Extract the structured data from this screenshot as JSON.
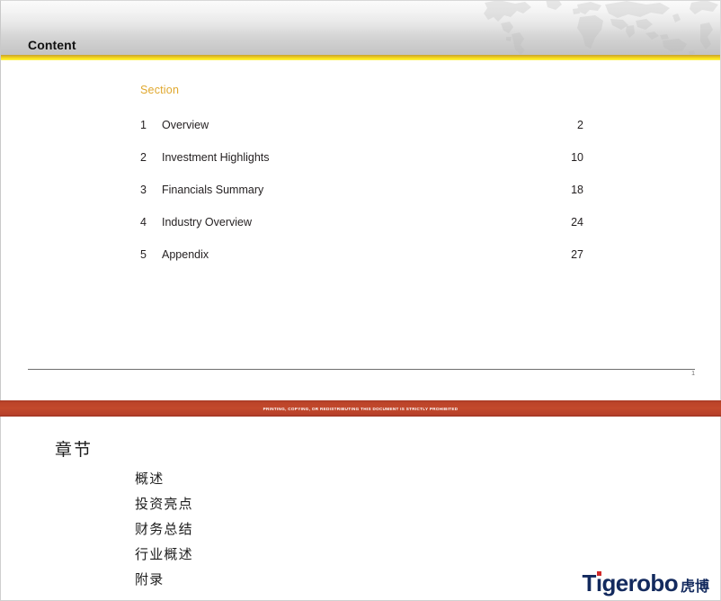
{
  "slide": {
    "header": {
      "title": "Content",
      "accent_color": "#f1d11f",
      "watermark": "world-map"
    },
    "toc": {
      "heading": "Section",
      "heading_color": "#e0a82e",
      "rows": [
        {
          "num": "1",
          "label": "Overview",
          "page": "2"
        },
        {
          "num": "2",
          "label": "Investment Highlights",
          "page": "10"
        },
        {
          "num": "3",
          "label": "Financials Summary",
          "page": "18"
        },
        {
          "num": "4",
          "label": "Industry Overview",
          "page": "24"
        },
        {
          "num": "5",
          "label": "Appendix",
          "page": "27"
        }
      ]
    },
    "page_number": "1"
  },
  "prohibition": {
    "text": "PRINTING, COPYING, OR REDISTRIBUTING THIS DOCUMENT IS STRICTLY PROHIBITED",
    "bar_color": "#c2492c"
  },
  "translation": {
    "heading": "章节",
    "items": [
      "概述",
      "投资亮点",
      "财务总结",
      "行业概述",
      "附录"
    ]
  },
  "logo": {
    "word_part1": "T",
    "word_i": "i",
    "word_part2": "gerobo",
    "cn": "虎博",
    "brand_color": "#132a5e",
    "accent_color": "#d12b2b"
  }
}
